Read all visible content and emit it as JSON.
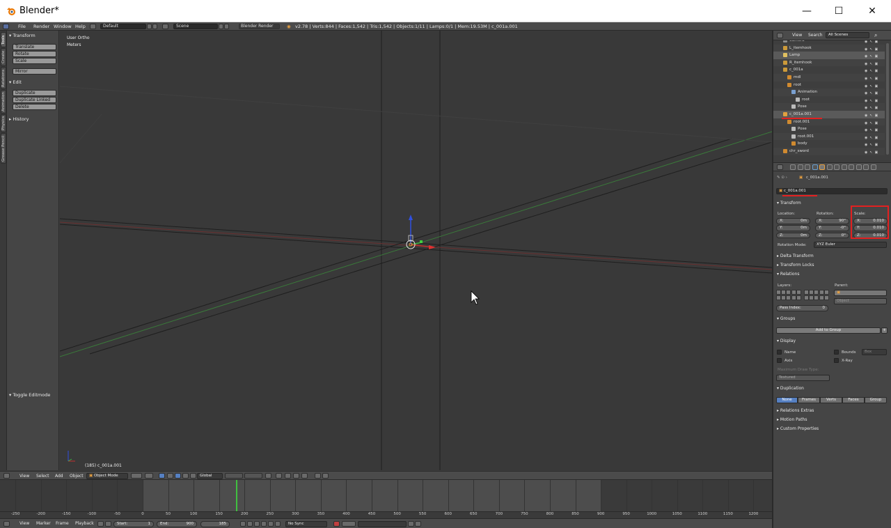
{
  "window": {
    "title": "Blender*",
    "minimize": "—",
    "maximize": "☐",
    "close": "✕"
  },
  "topbar": {
    "menus": [
      "File",
      "Render",
      "Window",
      "Help"
    ],
    "layout": "Default",
    "scene": "Scene",
    "engine": "Blender Render",
    "stats": "v2.78 | Verts:844 | Faces:1,542 | Tris:1,542 | Objects:1/11 | Lamps:0/1 | Mem:19.53M | c_001a.001"
  },
  "tabs": [
    "Tools",
    "Create",
    "Relations",
    "Animation",
    "Physics",
    "Grease Pencil"
  ],
  "shelf": {
    "transform_header": "Transform",
    "transform_buttons": [
      "Translate",
      "Rotate",
      "Scale"
    ],
    "mirror": "Mirror",
    "edit_header": "Edit",
    "edit_buttons": [
      "Duplicate",
      "Duplicate Linked",
      "Delete"
    ],
    "history": "History",
    "toggle": "Toggle Editmode"
  },
  "viewport": {
    "view": "User Ortho",
    "units": "Meters",
    "status": "(185) c_001a.001"
  },
  "outliner": {
    "view": "View",
    "search": "Search",
    "scenes": "All Scenes",
    "rows": [
      {
        "name": "Camera",
        "indent": 2,
        "color": "#8c8c8c"
      },
      {
        "name": "L_itemhook",
        "indent": 2,
        "color": "#cc9a3a"
      },
      {
        "name": "Lamp",
        "indent": 2,
        "color": "#e0c060"
      },
      {
        "name": "R_itemhook",
        "indent": 2,
        "color": "#cc9a3a"
      },
      {
        "name": "c_001a",
        "indent": 2,
        "color": "#cc9a3a"
      },
      {
        "name": "mdl",
        "indent": 3,
        "color": "#d08a30"
      },
      {
        "name": "root",
        "indent": 3,
        "color": "#d08a30"
      },
      {
        "name": "Animation",
        "indent": 4,
        "color": "#7aa0d0"
      },
      {
        "name": "root",
        "indent": 5,
        "color": "#bbbbbb"
      },
      {
        "name": "Pose",
        "indent": 4,
        "color": "#bbbbbb"
      },
      {
        "name": "c_001a.001",
        "indent": 2,
        "color": "#e0a040"
      },
      {
        "name": "root.001",
        "indent": 3,
        "color": "#d08a30"
      },
      {
        "name": "Pose",
        "indent": 4,
        "color": "#bbbbbb"
      },
      {
        "name": "root.001",
        "indent": 4,
        "color": "#bbbbbb"
      },
      {
        "name": "body",
        "indent": 4,
        "color": "#d08a30"
      },
      {
        "name": "chr_sword",
        "indent": 2,
        "color": "#d08a30"
      }
    ]
  },
  "properties": {
    "breadcrumb": "c_001a.001",
    "object_name": "c_001a.001",
    "transform": "Transform",
    "location_label": "Location:",
    "rotation_label": "Rotation:",
    "scale_label": "Scale:",
    "location": [
      {
        "axis": "X:",
        "val": "0m"
      },
      {
        "axis": "Y:",
        "val": "0m"
      },
      {
        "axis": "Z:",
        "val": "0m"
      }
    ],
    "rotation": [
      {
        "axis": "X:",
        "val": "90°"
      },
      {
        "axis": "Y:",
        "val": "-0°"
      },
      {
        "axis": "Z:",
        "val": "0°"
      }
    ],
    "scale": [
      {
        "axis": "X:",
        "val": "0.010"
      },
      {
        "axis": "Y:",
        "val": "0.010"
      },
      {
        "axis": "Z:",
        "val": "0.010"
      }
    ],
    "rotation_mode_label": "Rotation Mode:",
    "rotation_mode": "XYZ Euler",
    "delta_transform": "Delta Transform",
    "transform_locks": "Transform Locks",
    "relations": "Relations",
    "layers_label": "Layers:",
    "parent_label": "Parent:",
    "parent_type": "Object",
    "pass_index_label": "Pass Index:",
    "pass_index": "0",
    "groups": "Groups",
    "add_to_group": "Add to Group",
    "display": "Display",
    "name": "Name",
    "axis": "Axis",
    "bounds": "Bounds",
    "bounds_type": "Box",
    "xray": "X-Ray",
    "max_draw_type_label": "Maximum Draw Type:",
    "max_draw_type": "Textured",
    "duplication": "Duplication",
    "dup_options": [
      "None",
      "Frames",
      "Verts",
      "Faces",
      "Group"
    ],
    "relations_extras": "Relations Extras",
    "motion_paths": "Motion Paths",
    "custom_properties": "Custom Properties"
  },
  "vp_header": {
    "view": "View",
    "select": "Select",
    "add": "Add",
    "object": "Object",
    "mode": "Object Mode",
    "orientation": "Global"
  },
  "timeline": {
    "ticks": [
      "-250",
      "-200",
      "-150",
      "-100",
      "-50",
      "0",
      "50",
      "100",
      "150",
      "200",
      "250",
      "300",
      "350",
      "400",
      "450",
      "500",
      "550",
      "600",
      "650",
      "700",
      "750",
      "800",
      "850",
      "900",
      "950",
      "1000",
      "1050",
      "1100",
      "1150",
      "1200"
    ],
    "view": "View",
    "marker": "Marker",
    "frame": "Frame",
    "playback": "Playback",
    "start_label": "Start:",
    "start": "1",
    "end_label": "End:",
    "end": "900",
    "current": "185",
    "sync": "No Sync"
  },
  "colors": {
    "accent": "#5680c2",
    "highlight": "#e32020",
    "x_axis": "#b03030",
    "y_axis": "#40b040",
    "z_axis": "#3050e0"
  }
}
